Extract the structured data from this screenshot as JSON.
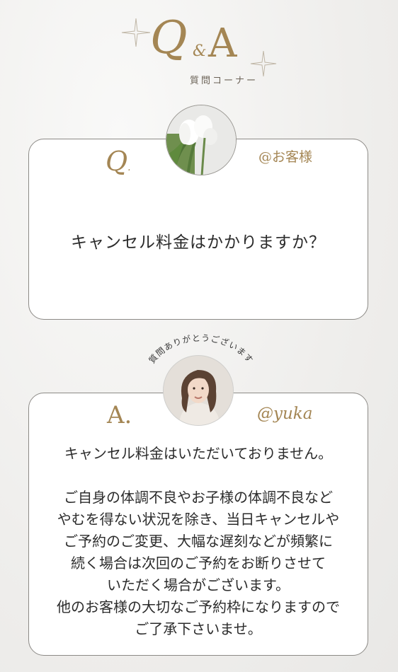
{
  "header": {
    "logo_q": "Q",
    "logo_amp": "&",
    "logo_a": "A",
    "subtitle": "質問コーナー"
  },
  "question_card": {
    "mark": "Q",
    "mark_dot": ".",
    "handle": "@お客様",
    "text": "キャンセル料金はかかりますか？",
    "avatar_icon": "tulip-photo"
  },
  "arc_caption": "質問ありがとうございます",
  "answer_card": {
    "mark": "A.",
    "handle": "@yuka",
    "avatar_icon": "staff-portrait-photo",
    "lines": [
      "キャンセル料金はいただいておりません。",
      "",
      "ご自身の体調不良やお子様の体調不良など",
      "やむを得ない状況を除き、当日キャンセルや",
      "ご予約のご変更、大幅な遅刻などが頻繁に",
      "続く場合は次回のご予約をお断りさせて",
      "いただく場合がございます。",
      "他のお客様の大切なご予約枠になりますので",
      "ご了承下さいませ。"
    ]
  },
  "colors": {
    "accent_gold": "#a48654",
    "border": "#8c8a86",
    "background": "#efeeec"
  }
}
